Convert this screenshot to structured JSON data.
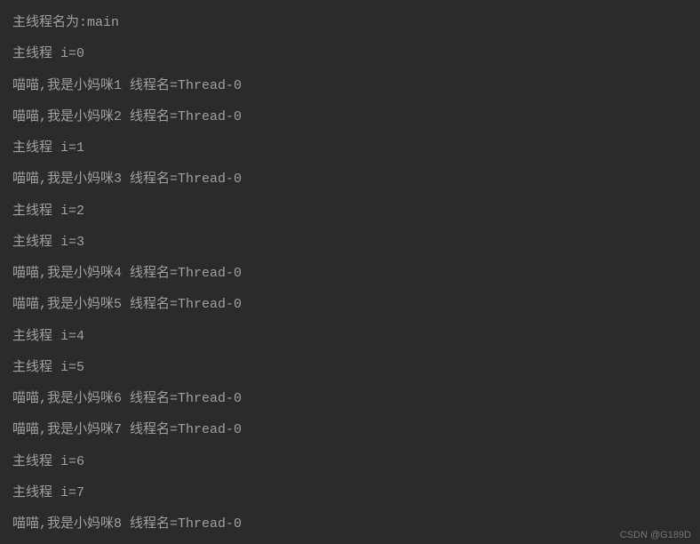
{
  "console": {
    "lines": [
      "主线程名为:main",
      "主线程 i=0",
      "喵喵,我是小妈咪1 线程名=Thread-0",
      "喵喵,我是小妈咪2 线程名=Thread-0",
      "主线程 i=1",
      "喵喵,我是小妈咪3 线程名=Thread-0",
      "主线程 i=2",
      "主线程 i=3",
      "喵喵,我是小妈咪4 线程名=Thread-0",
      "喵喵,我是小妈咪5 线程名=Thread-0",
      "主线程 i=4",
      "主线程 i=5",
      "喵喵,我是小妈咪6 线程名=Thread-0",
      "喵喵,我是小妈咪7 线程名=Thread-0",
      "主线程 i=6",
      "主线程 i=7",
      "喵喵,我是小妈咪8 线程名=Thread-0"
    ]
  },
  "watermark": "CSDN @G189D"
}
